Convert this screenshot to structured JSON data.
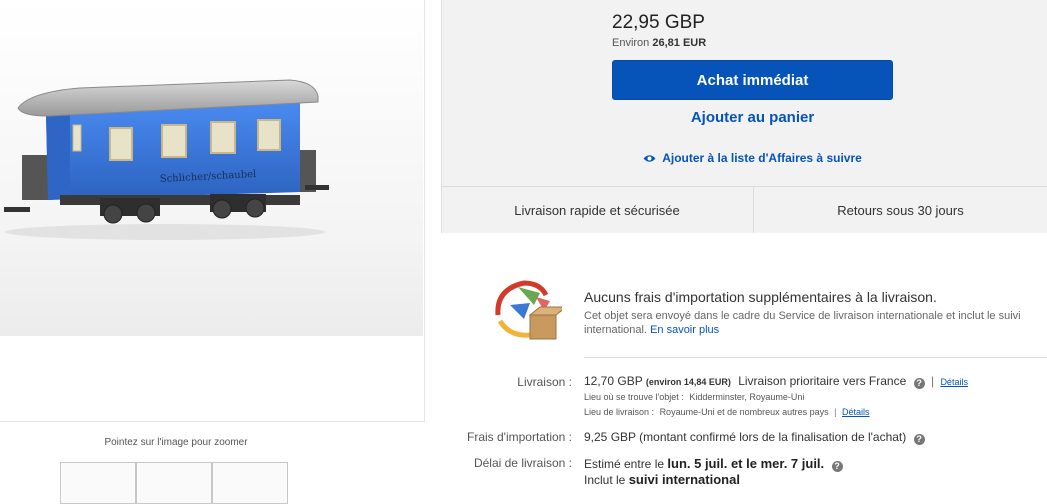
{
  "image": {
    "zoom_hint": "Pointez sur l'image pour zoomer",
    "carriage_lettering": "Schlicher/schaubel"
  },
  "price": {
    "amount": "22,95 GBP",
    "approx_prefix": "Environ",
    "approx_value": "26,81 EUR"
  },
  "actions": {
    "buy_now": "Achat immédiat",
    "add_to_cart": "Ajouter au panier",
    "watch": "Ajouter à la liste d'Affaires à suivre"
  },
  "benefits": {
    "fast_shipping": "Livraison rapide et sécurisée",
    "returns": "Retours sous 30 jours"
  },
  "import": {
    "title": "Aucuns frais d'importation supplémentaires à la livraison.",
    "description": "Cet objet sera envoyé dans le cadre du Service de livraison internationale et inclut le suivi international.",
    "learn_more": "En savoir plus"
  },
  "shipping": {
    "label": "Livraison :",
    "price": "12,70 GBP",
    "approx": "(environ 14,84 EUR)",
    "method": "Livraison prioritaire vers France",
    "details": "Détails",
    "item_location_label": "Lieu où se trouve l'objet :",
    "item_location": "Kidderminster, Royaume-Uni",
    "ship_to_label": "Lieu de livraison :",
    "ship_to": "Royaume-Uni et de nombreux autres pays",
    "ship_to_details": "Détails"
  },
  "import_fees": {
    "label": "Frais d'importation :",
    "amount": "9,25 GBP",
    "note": "(montant confirmé lors de la finalisation de l'achat)"
  },
  "delivery": {
    "label": "Délai de livraison :",
    "prefix": "Estimé entre le",
    "range": "lun. 5 juil. et le mer. 7 juil.",
    "tracking_prefix": "Inclut le",
    "tracking": "suivi international"
  },
  "colors": {
    "primary_blue": "#0654ba",
    "panel_gray": "#f2f2f2",
    "carriage_blue": "#3a77d6"
  }
}
